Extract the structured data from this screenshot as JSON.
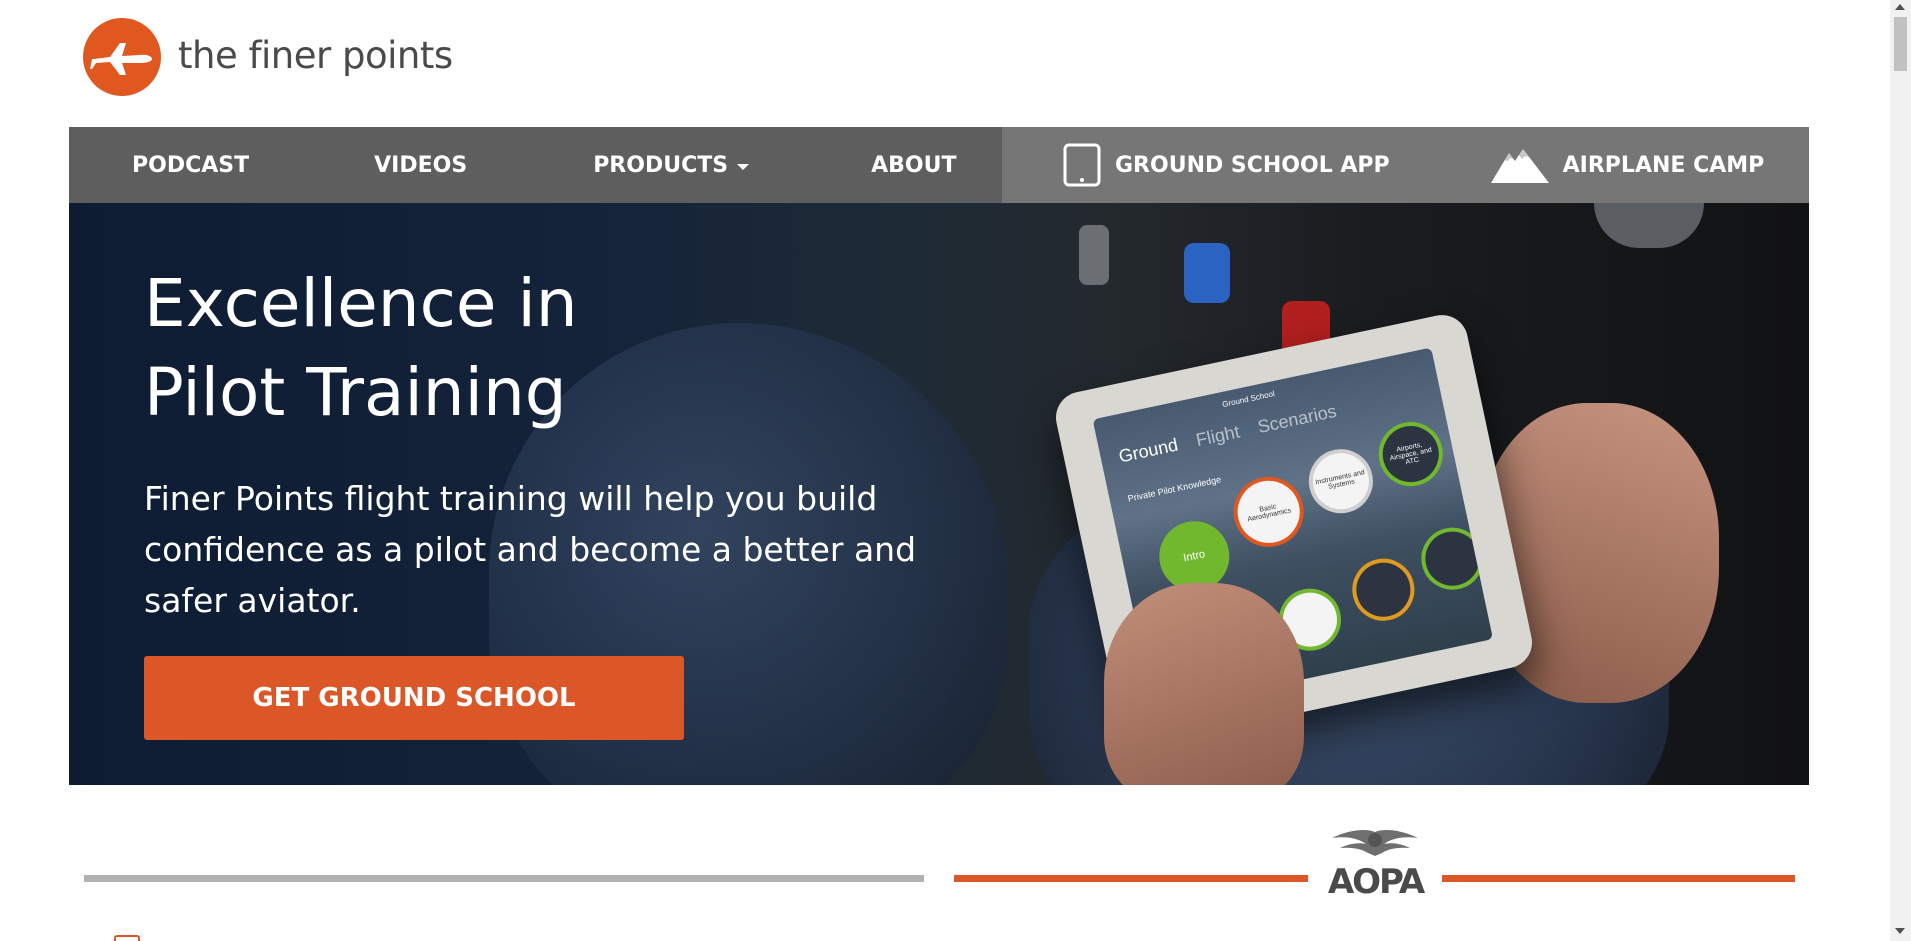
{
  "header": {
    "site_name": "the finer points",
    "logo_icon": "airplane-icon",
    "brand_color": "#e0571f"
  },
  "nav": {
    "items": [
      {
        "label": "PODCAST"
      },
      {
        "label": "VIDEOS"
      },
      {
        "label": "PRODUCTS"
      },
      {
        "label": "ABOUT"
      }
    ],
    "featured": [
      {
        "label": "GROUND SCHOOL APP",
        "icon": "tablet-icon"
      },
      {
        "label": "AIRPLANE CAMP",
        "icon": "mountain-icon"
      }
    ],
    "colors": {
      "bar": "#5f5e5e",
      "featured_bar": "#777676"
    }
  },
  "hero": {
    "title_line1": "Excellence in",
    "title_line2": "Pilot Training",
    "description": "Finer Points flight training will help you build confidence as a pilot and become a better and safer aviator.",
    "cta_label": "GET GROUND SCHOOL",
    "cta_color": "#dc5728",
    "tablet_screen": {
      "app_title": "Ground School",
      "tabs": [
        "Ground",
        "Flight",
        "Scenarios"
      ],
      "subtitle": "Private Pilot Knowledge",
      "bubbles": {
        "intro": "Intro",
        "c1": "Basic Aerodynamics",
        "c2": "Instruments and Systems",
        "c3": "Airports, Airspace, and ATC"
      }
    }
  },
  "partner": {
    "logo_text": "AOPA",
    "logo_icon": "aopa-wings-icon"
  }
}
